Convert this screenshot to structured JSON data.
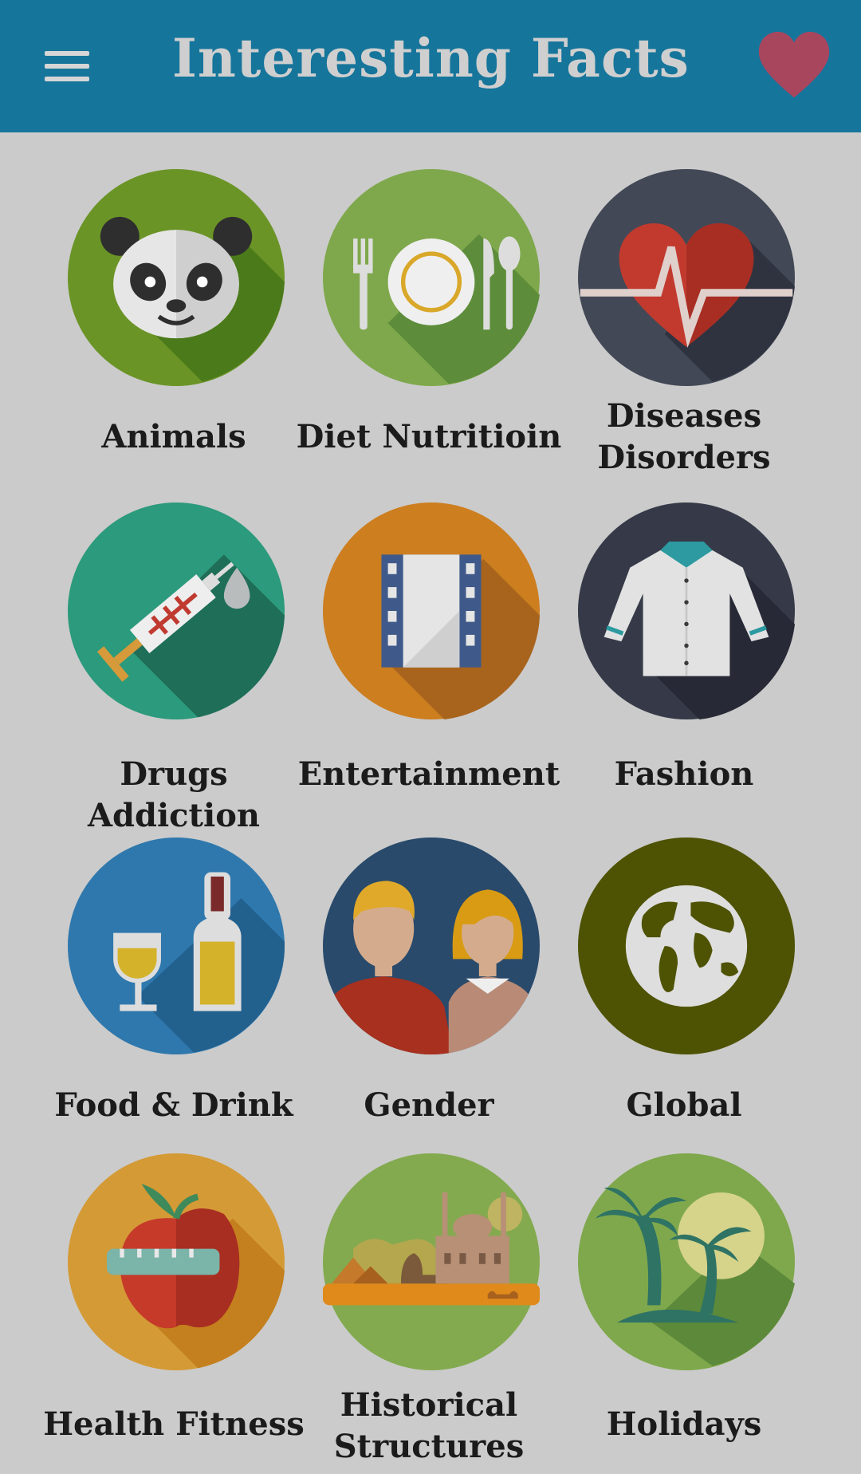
{
  "app_bar": {
    "title": "Interesting Facts",
    "menu_icon": "hamburger-menu-icon",
    "favorite_icon": "heart-icon"
  },
  "colors": {
    "app_bar": "#16759b",
    "background": "#cbcbcb",
    "title_text": "#cfcfcf",
    "heart": "#a8465e"
  },
  "categories": [
    {
      "label": "Animals",
      "icon": "panda-icon"
    },
    {
      "label": "Diet Nutritioin",
      "icon": "plate-cutlery-icon"
    },
    {
      "label": "Diseases\nDisorders",
      "icon": "heartbeat-icon"
    },
    {
      "label": "Drugs Addiction",
      "icon": "syringe-icon"
    },
    {
      "label": "Entertainment",
      "icon": "film-strip-icon"
    },
    {
      "label": "Fashion",
      "icon": "shirt-icon"
    },
    {
      "label": "Food & Drink",
      "icon": "wine-bottle-icon"
    },
    {
      "label": "Gender",
      "icon": "man-woman-icon"
    },
    {
      "label": "Global",
      "icon": "globe-icon"
    },
    {
      "label": "Health Fitness",
      "icon": "apple-measuring-tape-icon"
    },
    {
      "label": "Historical\nStructures",
      "icon": "pyramids-mosque-icon"
    },
    {
      "label": "Holidays",
      "icon": "palm-tree-icon"
    }
  ]
}
